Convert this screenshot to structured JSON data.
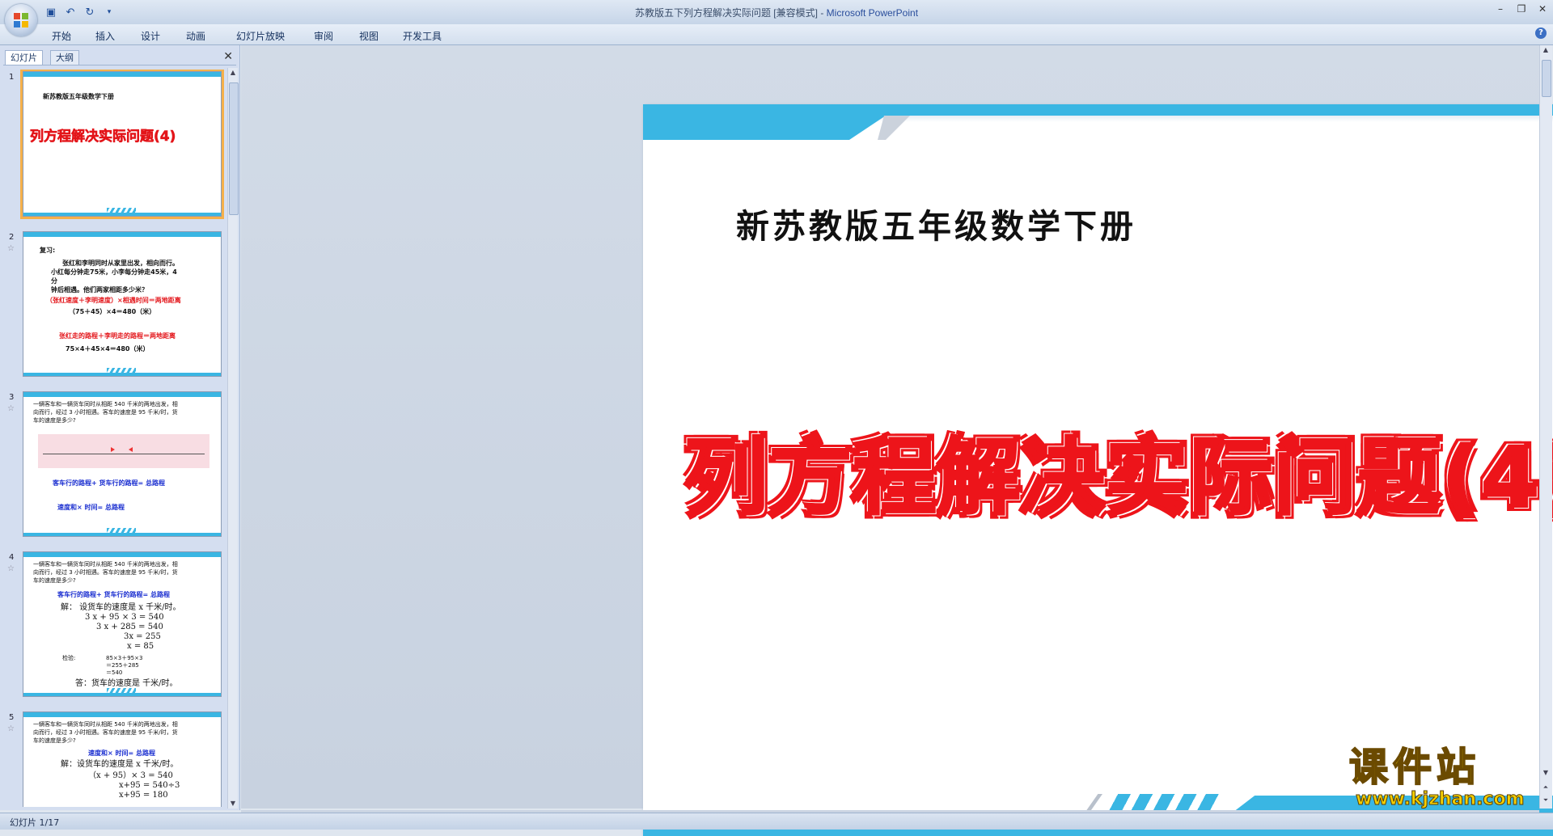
{
  "window": {
    "title": "苏教版五下列方程解决实际问题 [兼容模式]",
    "title_sep": " - ",
    "app_name": "Microsoft PowerPoint"
  },
  "ribbon": {
    "tabs": [
      {
        "label": "开始"
      },
      {
        "label": "插入"
      },
      {
        "label": "设计"
      },
      {
        "label": "动画"
      },
      {
        "label": "幻灯片放映"
      },
      {
        "label": "审阅"
      },
      {
        "label": "视图"
      },
      {
        "label": "开发工具"
      }
    ]
  },
  "pane": {
    "tab_slides": "幻灯片",
    "tab_outline": "大纲",
    "close_glyph": "✕"
  },
  "thumbnails": [
    {
      "num": "1",
      "subtitle": "新苏教版五年级数学下册",
      "title": "列方程解决实际问题(4)"
    },
    {
      "num": "2",
      "lines": [
        "复习:",
        "张红和李明同时从家里出发，相向而行。",
        "小红每分钟走75米，小李每分钟走45米，4",
        "分",
        "钟后相遇。他们两家相距多少米？",
        "（张红速度＋李明速度）×相遇时间＝两地距离",
        "（75＋45）×4＝480（米）",
        "张红走的路程＋李明走的路程＝两地距离",
        "75×4＋45×4＝480（米）"
      ]
    },
    {
      "num": "3",
      "lines": [
        "一辆客车和一辆货车同时从相距 540 千米的两地出发，相",
        "向而行，经过 3 小时相遇。客车的速度是 95 千米/时，货",
        "车的速度是多少?",
        "客车行的路程+ 货车行的路程= 总路程",
        "速度和× 时间= 总路程"
      ]
    },
    {
      "num": "4",
      "lines": [
        "一辆客车和一辆货车同时从相距 540 千米的两地出发，相",
        "向而行，经过 3 小时相遇。客车的速度是 95 千米/时，货",
        "车的速度是多少?",
        "客车行的路程+ 货车行的路程= 总路程",
        "解：  设货车的速度是 x 千米/时。",
        "3 x + 95 × 3 = 540",
        "3 x + 285 = 540",
        "3x = 255",
        "x = 85",
        "检验:",
        "85×3＋95×3",
        "＝255＋285",
        "＝540",
        "答：货车的速度是        千米/时。"
      ]
    },
    {
      "num": "5",
      "lines": [
        "一辆客车和一辆货车同时从相距 540 千米的两地出发，相",
        "向而行，经过 3 小时相遇。客车的速度是 95 千米/时，货",
        "车的速度是多少?",
        "速度和× 时间= 总路程",
        "解：设货车的速度是 x 千米/时。",
        "（x + 95）× 3 = 540",
        "x+95 = 540÷3",
        "x+95 = 180"
      ]
    }
  ],
  "slide": {
    "subtitle": "新苏教版五年级数学下册",
    "title": "列方程解决实际问题(4)"
  },
  "statusbar": {
    "text": "幻灯片 1/17"
  },
  "watermark": {
    "title": "课件站",
    "url": "www.kjzhan.com"
  },
  "colors": {
    "accent_blue": "#3ab6e3",
    "title_red": "#ed141a",
    "selection_orange": "#f5b04a"
  }
}
